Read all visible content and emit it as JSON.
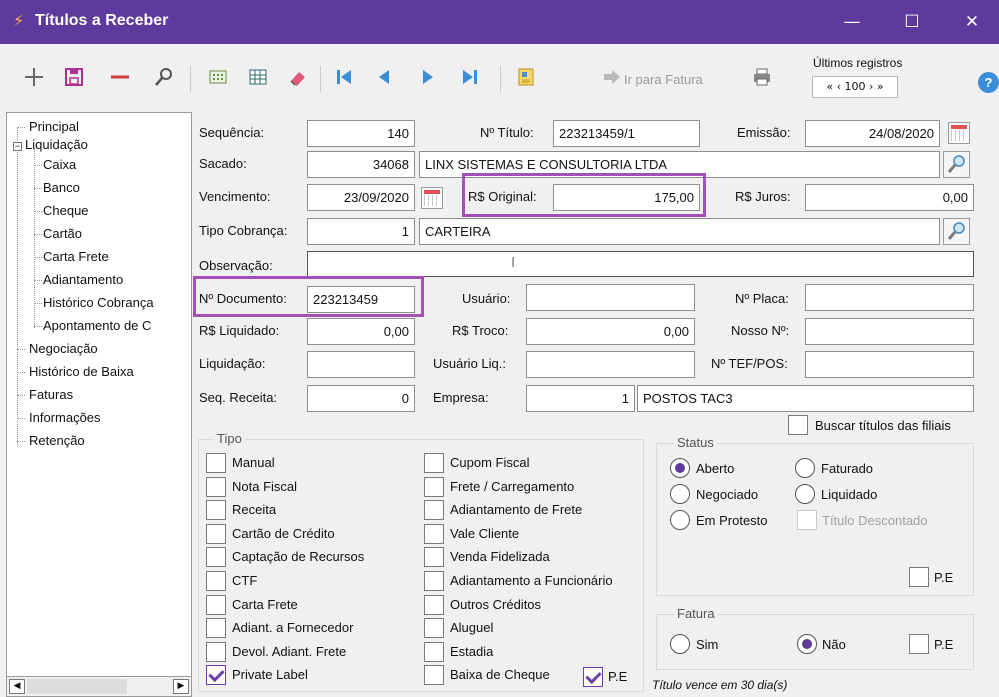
{
  "window": {
    "title": "Títulos a Receber",
    "minimize": "—",
    "maximize": "☐",
    "close": "✕"
  },
  "toolbar": {
    "ir_para_fatura": "Ir para Fatura",
    "ultimos_registros_label": "Últimos registros",
    "ultimos_registros_value": "« ‹ 100 › »",
    "help": "?"
  },
  "tree": {
    "principal": "Principal",
    "liquidacao": "Liquidação",
    "caixa": "Caixa",
    "banco": "Banco",
    "cheque": "Cheque",
    "cartao": "Cartão",
    "carta_frete": "Carta Frete",
    "adiantamento": "Adiantamento",
    "historico_cobranca": "Histórico Cobrança",
    "apontamento": "Apontamento de C",
    "negociacao": "Negociação",
    "historico_baixa": "Histórico de Baixa",
    "faturas": "Faturas",
    "informacoes": "Informações",
    "retencao": "Retenção"
  },
  "form": {
    "sequencia_label": "Sequência:",
    "sequencia": "140",
    "num_titulo_label": "Nº Título:",
    "num_titulo": "223213459/1",
    "emissao_label": "Emissão:",
    "emissao": "24/08/2020",
    "sacado_label": "Sacado:",
    "sacado_codigo": "34068",
    "sacado_nome": "LINX SISTEMAS E CONSULTORIA LTDA",
    "vencimento_label": "Vencimento:",
    "vencimento": "23/09/2020",
    "original_label": "R$ Original:",
    "original": "175,00",
    "juros_label": "R$ Juros:",
    "juros": "0,00",
    "tipo_cobranca_label": "Tipo Cobrança:",
    "tipo_cobranca_codigo": "1",
    "tipo_cobranca_nome": "CARTEIRA",
    "observacao_label": "Observação:",
    "observacao": "",
    "num_documento_label": "Nº Documento:",
    "num_documento": "223213459",
    "usuario_label": "Usuário:",
    "usuario": "",
    "num_placa_label": "Nº Placa:",
    "num_placa": "",
    "liquidado_label": "R$ Liquidado:",
    "liquidado": "0,00",
    "troco_label": "R$ Troco:",
    "troco": "0,00",
    "nosso_num_label": "Nosso Nº:",
    "nosso_num": "",
    "liquidacao_label": "Liquidação:",
    "liquidacao": "",
    "usuario_liq_label": "Usuário Liq.:",
    "usuario_liq": "",
    "tef_label": "Nº TEF/POS:",
    "tef": "",
    "seq_receita_label": "Seq. Receita:",
    "seq_receita": "0",
    "empresa_label": "Empresa:",
    "empresa_codigo": "1",
    "empresa_nome": "POSTOS TAC3",
    "buscar_filiais_label": "Buscar títulos das filiais"
  },
  "tipo": {
    "title": "Tipo",
    "col1": [
      "Manual",
      "Nota Fiscal",
      "Receita",
      "Cartão de Crédito",
      "Captação de Recursos",
      "CTF",
      "Carta Frete",
      "Adiant. a Fornecedor",
      "Devol. Adiant. Frete",
      "Private Label"
    ],
    "col2": [
      "Cupom Fiscal",
      "Frete / Carregamento",
      "Adiantamento de Frete",
      "Vale Cliente",
      "Venda Fidelizada",
      "Adiantamento a Funcionário",
      "Outros Créditos",
      "Aluguel",
      "Estadia",
      "Baixa de Cheque"
    ],
    "pe_label": "P.E"
  },
  "status": {
    "title": "Status",
    "aberto": "Aberto",
    "faturado": "Faturado",
    "negociado": "Negociado",
    "liquidado": "Liquidado",
    "em_protesto": "Em Protesto",
    "titulo_descontado": "Título Descontado",
    "pe_label": "P.E"
  },
  "fatura": {
    "title": "Fatura",
    "sim": "Sim",
    "nao": "Não",
    "pe_label": "P.E"
  },
  "note": "Título vence em 30 dia(s)"
}
